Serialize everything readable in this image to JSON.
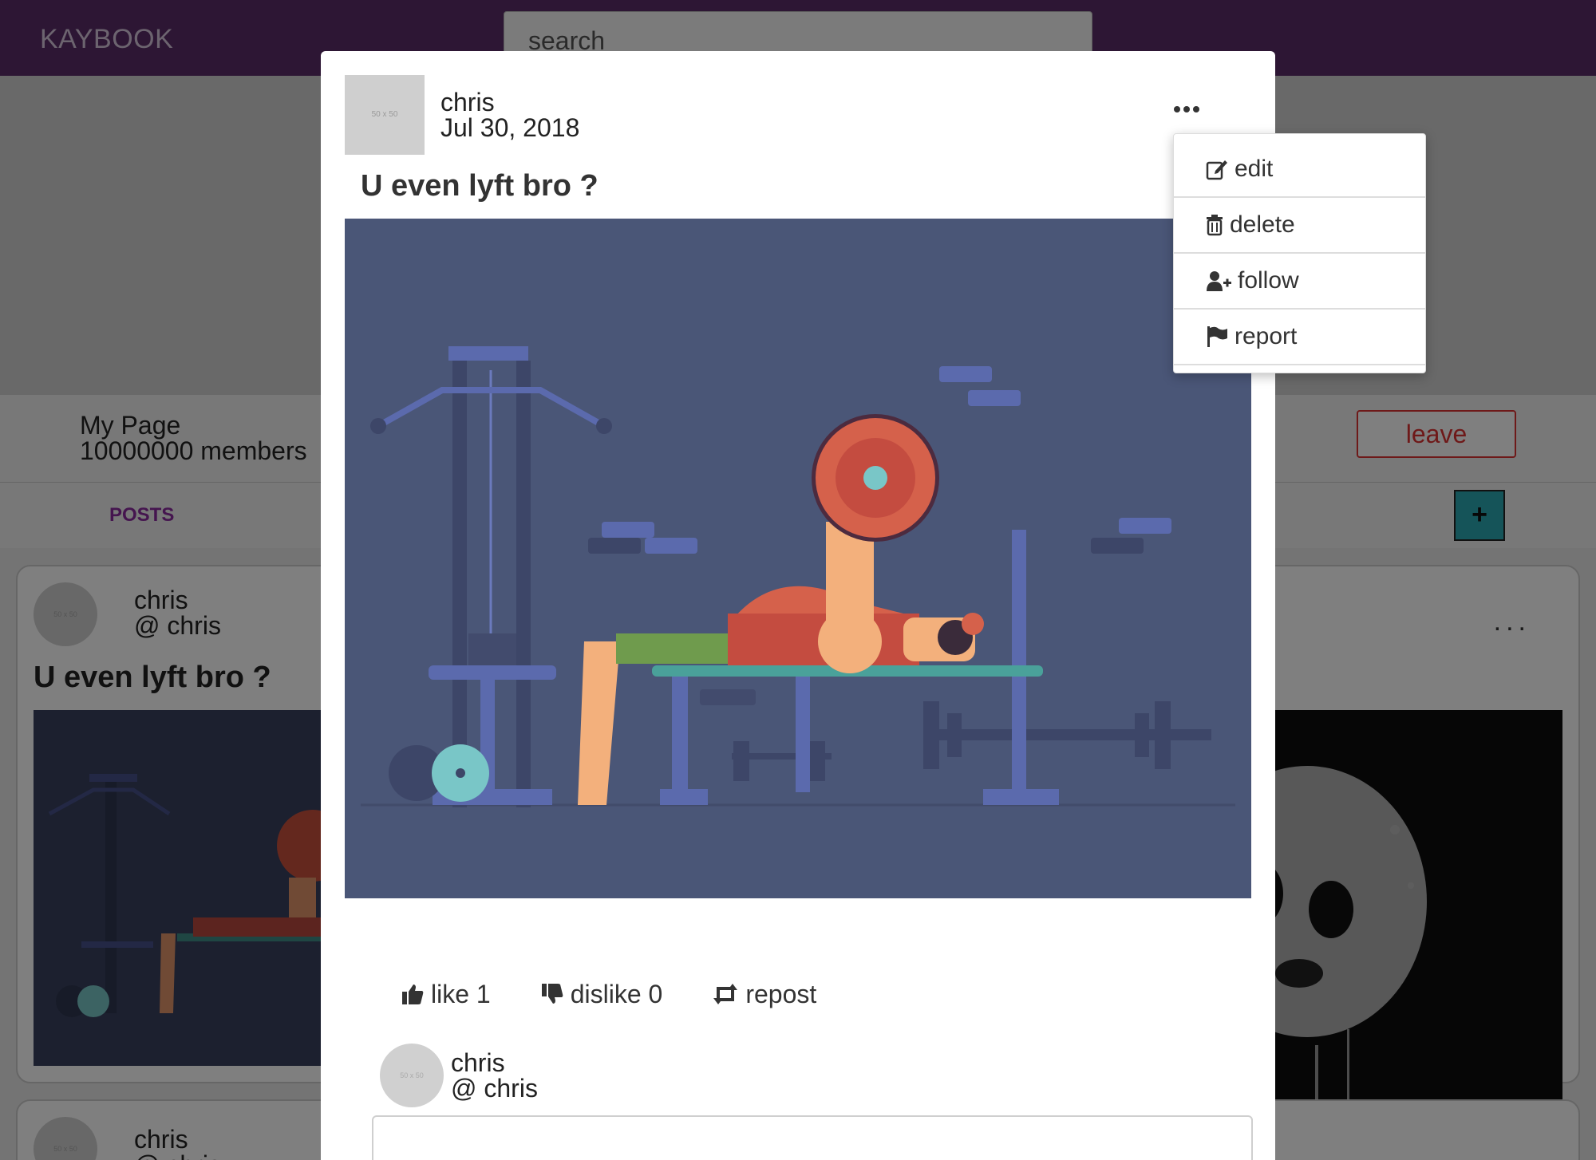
{
  "navbar": {
    "brand": "KAYBOOK",
    "search_placeholder": "search"
  },
  "page": {
    "name": "My Page",
    "members": "10000000 members",
    "leave_label": "leave"
  },
  "tabs": {
    "posts_label": "POSTS",
    "add_label": "+"
  },
  "feed": [
    {
      "author": "chris",
      "handle": "@ chris",
      "title": "U even lyft bro ?",
      "more_label": "..."
    },
    {
      "author": "chris",
      "handle": "@ chris"
    }
  ],
  "avatar_placeholder": "50 x 50",
  "modal": {
    "author": "chris",
    "date": "Jul 30, 2018",
    "title": "U even lyft bro ?",
    "actions": [
      {
        "label": "like 1",
        "icon": "thumbs-up-icon"
      },
      {
        "label": "dislike 0",
        "icon": "thumbs-down-icon"
      },
      {
        "label": "repost",
        "icon": "retweet-icon"
      }
    ],
    "commenter": {
      "name": "chris",
      "handle": "@ chris"
    }
  },
  "dropdown": [
    {
      "label": "edit",
      "icon": "edit-icon"
    },
    {
      "label": "delete",
      "icon": "trash-icon"
    },
    {
      "label": "follow",
      "icon": "user-plus-icon"
    },
    {
      "label": "report",
      "icon": "flag-icon"
    }
  ],
  "colors": {
    "navbar": "#5a2d68",
    "accent_purple": "#8a2b9e",
    "leave_red": "#dd3333",
    "add_teal": "#2aa8b3",
    "image_bg": "#4a5677"
  }
}
